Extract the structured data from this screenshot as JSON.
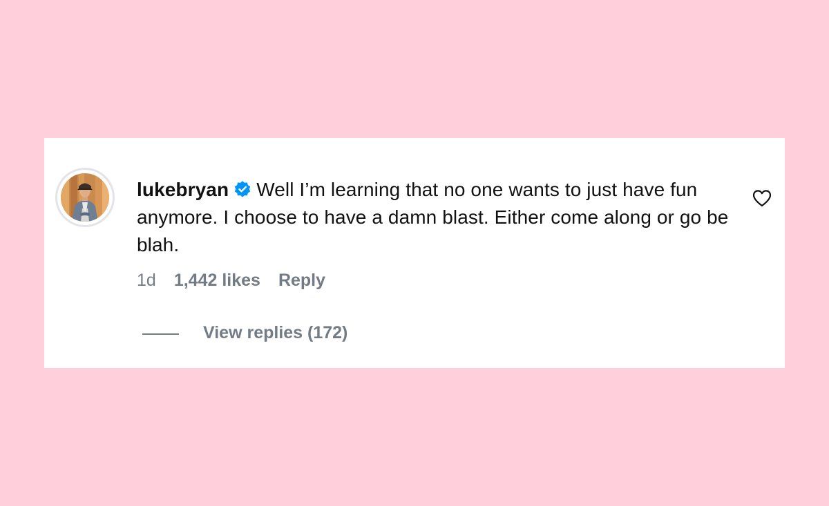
{
  "comment": {
    "username": "lukebryan",
    "verified_icon": "verified-badge-icon",
    "text": "Well I’m learning that no one wants to just have fun anymore. I choose to have a damn blast. Either come along or go be blah.",
    "timestamp": "1d",
    "likes": "1,442 likes",
    "reply_label": "Reply",
    "view_replies_label": "View replies (172)",
    "like_icon": "heart-outline-icon"
  },
  "colors": {
    "background": "#ffd0db",
    "card": "#ffffff",
    "text": "#111111",
    "muted": "#737b85",
    "verified": "#0095f6"
  }
}
